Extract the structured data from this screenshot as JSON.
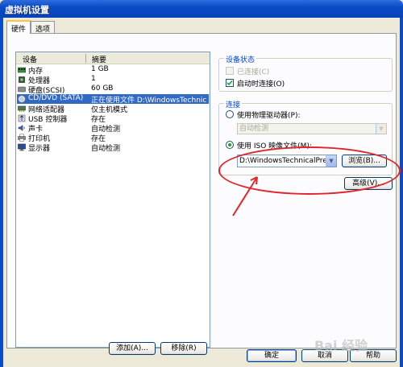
{
  "window": {
    "title": "虚拟机设置"
  },
  "tabs": [
    {
      "label": "硬件"
    },
    {
      "label": "选项"
    }
  ],
  "device_list": {
    "headers": [
      "设备",
      "摘要"
    ],
    "rows": [
      {
        "icon": "memory-icon",
        "device": "内存",
        "summary": "1 GB"
      },
      {
        "icon": "processor-icon",
        "device": "处理器",
        "summary": "1"
      },
      {
        "icon": "hard-disk-icon",
        "device": "硬盘(SCSI)",
        "summary": "60 GB"
      },
      {
        "icon": "cd-dvd-icon",
        "device": "CD/DVD (SATA)",
        "summary": "正在使用文件 D:\\WindowsTechnical..."
      },
      {
        "icon": "network-adapter-icon",
        "device": "网络适配器",
        "summary": "仅主机模式"
      },
      {
        "icon": "usb-controller-icon",
        "device": "USB 控制器",
        "summary": "存在"
      },
      {
        "icon": "sound-card-icon",
        "device": "声卡",
        "summary": "自动检测"
      },
      {
        "icon": "printer-icon",
        "device": "打印机",
        "summary": "存在"
      },
      {
        "icon": "display-icon",
        "device": "显示器",
        "summary": "自动检测"
      }
    ],
    "selected_index": 3
  },
  "list_buttons": {
    "add": "添加(A)...",
    "remove": "移除(R)"
  },
  "device_status": {
    "title": "设备状态",
    "connected": {
      "label": "已连接(C)",
      "checked": false,
      "enabled": false
    },
    "connect_on_power": {
      "label": "启动时连接(O)",
      "checked": true
    }
  },
  "connection": {
    "title": "连接",
    "physical": {
      "label": "使用物理驱动器(P):",
      "selected": false,
      "dropdown_value": "自动检测"
    },
    "iso": {
      "label": "使用 ISO 映像文件(M):",
      "selected": true,
      "value": "D:\\WindowsTechnicalPreview",
      "browse": "浏览(B)..."
    }
  },
  "advanced_button": "高级(V)...",
  "footer": {
    "ok": "确定",
    "cancel": "取消",
    "help": "帮助"
  },
  "watermark": "Bai 经验",
  "colors": {
    "selection": "#316AC5",
    "annotation": "#E2252A",
    "titlebar": "#0A4CC6"
  }
}
